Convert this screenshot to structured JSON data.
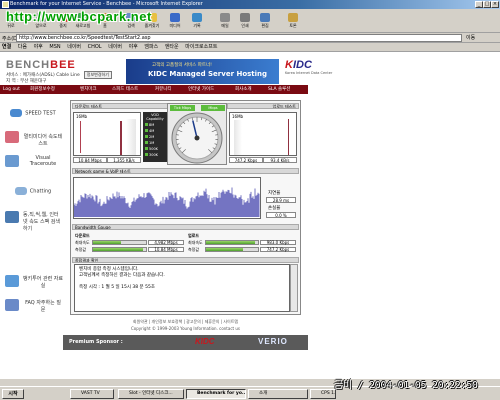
{
  "window": {
    "title": "Benchmark for your Internet Service - Benchbee - Microsoft Internet Explorer",
    "minimize": "_",
    "maximize": "□",
    "close": "×"
  },
  "watermark": "http://www.bcpark.net",
  "toolbar": {
    "back": "뒤로",
    "forward": "앞으로",
    "stop": "중지",
    "refresh": "새로고침",
    "home": "홈",
    "search": "검색",
    "favorites": "즐겨찾기",
    "media": "미디어",
    "history": "기록",
    "mail": "메일",
    "print": "인쇄",
    "edit": "편집",
    "messenger": "토론"
  },
  "address": {
    "label": "주소(D)",
    "url": "http://www.benchbee.co.kr/Speedtest/TestStart2.asp",
    "go": "이동"
  },
  "links": {
    "label": "연결",
    "items": [
      "다음",
      "야후",
      "MSN",
      "네이버",
      "CHOL",
      "네이버",
      "야후",
      "엠파스",
      "엔타운",
      "마이크로소프트"
    ]
  },
  "site": {
    "logo_a": "BENCH",
    "logo_b": "BEE",
    "info_line1": "서비스 : 메가패스(ADSL) Cable Line",
    "info_line2": "지   역 : 부산 해운대구",
    "info_button": "정보변경하기",
    "banner_line1": "고객의 고품질의 서비스 파트너!",
    "banner_line2": "KIDC Managed Server Hosting",
    "kidc_logo_a": "K",
    "kidc_logo_b": "IDC",
    "kidc_sub": "Korea Internet Data Center"
  },
  "nav": {
    "logout": "Log out",
    "items": [
      "회원정보수정",
      "벤치마크",
      "스피드 테스트",
      "커뮤니티",
      "인터넷 가이드",
      "회사소개",
      "SLA 솔루션"
    ]
  },
  "sidebar": {
    "items": [
      "SPEED TEST",
      "멀티미디어 속도테스트",
      "Visual Traceroute",
      "Chatting",
      "동,직,씩,웹, 인터넷 속도 스팩 검색하기",
      "뱅키투어 관련 자료실",
      "FAQ 자주하는 질문"
    ]
  },
  "test": {
    "download_header": "다운로드 테스트",
    "upload_header": "업로드 테스트",
    "graph_top": "16Mb",
    "download_values": [
      "10.84 Mbps",
      "1,355 KB/s"
    ],
    "upload_values": [
      "747.2 Kbps",
      "93.4 KB/s"
    ],
    "capability_label": "VOD Capability",
    "capability_levels": [
      "300K",
      "500K",
      "1M",
      "2M",
      "4M",
      "8M"
    ],
    "gauge_label_left": "Tick Mbps",
    "gauge_label_right": "Mbps",
    "gauge_value_fraction": 0.45,
    "network_header": "Network game & VoIP 테스트",
    "ping_label": "지연율",
    "ping_value": "28.9 ms",
    "loss_label": "손실율",
    "loss_value": "0.0 %",
    "bandwidth_header": "Bandwidth Gauge",
    "bw_download_label": "다운로드",
    "bw_upload_label": "업로드",
    "bw_rows_down": [
      {
        "label": "최대속도",
        "value": "4,982 Mbps",
        "fill": 0.52
      },
      {
        "label": "측정값",
        "value": "10.84 Mbps",
        "fill": 0.95
      }
    ],
    "bw_rows_up": [
      {
        "label": "최대속도",
        "value": "983.0 Kbps",
        "fill": 0.95
      },
      {
        "label": "측정값",
        "value": "747.2 Kbps",
        "fill": 0.72
      }
    ],
    "result_header": "종합결과 확인",
    "result_lines": [
      "벤치비 종합 측정 시스템입니다.",
      "고객님께서 측정하신 결과는 다음과 같습니다.",
      "",
      "측정 시각 :      1 월 5 일    15시 38 분 55초"
    ]
  },
  "footer": {
    "links": "회원약관  |  개인정보 보호정책  |  광고문의  |  제휴문의  |  사이트맵",
    "copyright": "Copyright © 1999-2003 Young Information.  contact us"
  },
  "sponsor": {
    "label": "Premium Sponsor :",
    "kidc": "KIDC",
    "veri": "VERIO"
  },
  "taskbar": {
    "start": "시작",
    "tasks": [
      "VAST TV",
      "Slot - 인터넷 디스크...",
      "Benchmark for yo...",
      "소개",
      "CPS 1.1"
    ],
    "stamp": "금비 / 2004-01-05 20:22:50"
  }
}
